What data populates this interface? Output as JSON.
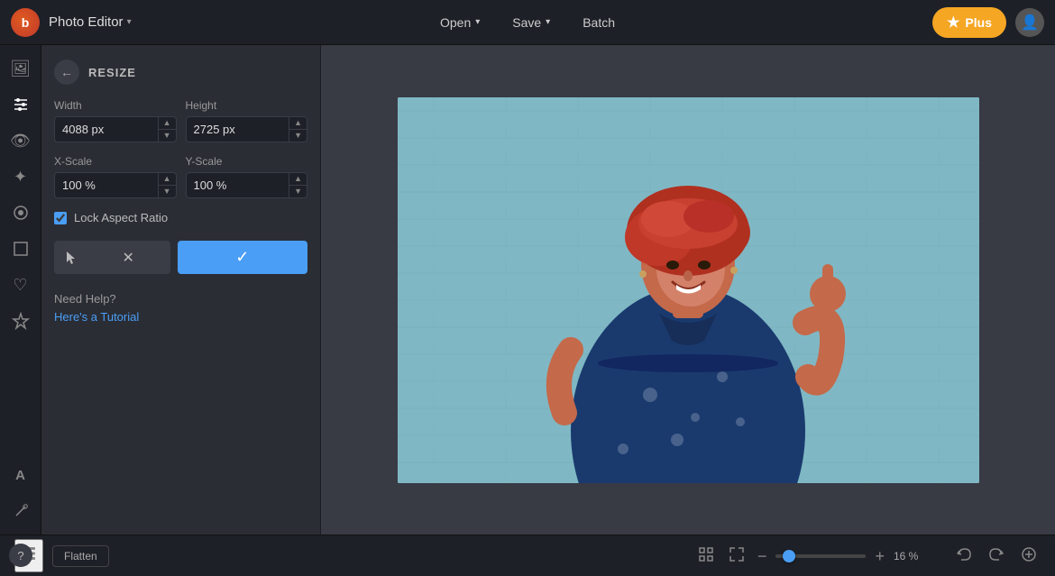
{
  "header": {
    "logo_letter": "b",
    "app_title": "Photo Editor",
    "app_chevron": "▾",
    "open_label": "Open",
    "open_chevron": "▾",
    "save_label": "Save",
    "save_chevron": "▾",
    "batch_label": "Batch",
    "plus_star": "★",
    "plus_label": "Plus",
    "avatar_icon": "👤"
  },
  "sidebar_icons": [
    {
      "name": "image-icon",
      "glyph": "🖼",
      "active": false
    },
    {
      "name": "sliders-icon",
      "glyph": "⚙",
      "active": true
    },
    {
      "name": "eye-icon",
      "glyph": "👁",
      "active": false
    },
    {
      "name": "star-icon",
      "glyph": "✦",
      "active": false
    },
    {
      "name": "effects-icon",
      "glyph": "❋",
      "active": false
    },
    {
      "name": "frame-icon",
      "glyph": "▭",
      "active": false
    },
    {
      "name": "heart-icon",
      "glyph": "♡",
      "active": false
    },
    {
      "name": "sticker-icon",
      "glyph": "◈",
      "active": false
    },
    {
      "name": "text-icon",
      "glyph": "A",
      "active": false
    },
    {
      "name": "brush-icon",
      "glyph": "⌇",
      "active": false
    }
  ],
  "panel": {
    "back_arrow": "←",
    "title": "RESIZE",
    "width_label": "Width",
    "width_value": "4088 px",
    "height_label": "Height",
    "height_value": "2725 px",
    "x_scale_label": "X-Scale",
    "x_scale_value": "100 %",
    "y_scale_label": "Y-Scale",
    "y_scale_value": "100 %",
    "lock_aspect_label": "Lock Aspect Ratio",
    "cancel_x": "✕",
    "confirm_check": "✓",
    "help_text": "Need Help?",
    "tutorial_link": "Here's a Tutorial"
  },
  "bottom_bar": {
    "layers_icon": "⊞",
    "flatten_label": "Flatten",
    "fit_icon": "⛶",
    "fullscreen_icon": "⤢",
    "zoom_minus": "−",
    "zoom_plus": "+",
    "zoom_percent": "16 %",
    "undo_icon": "↩",
    "redo_icon": "↪",
    "more_icon": "⊕"
  },
  "help_button_label": "?"
}
